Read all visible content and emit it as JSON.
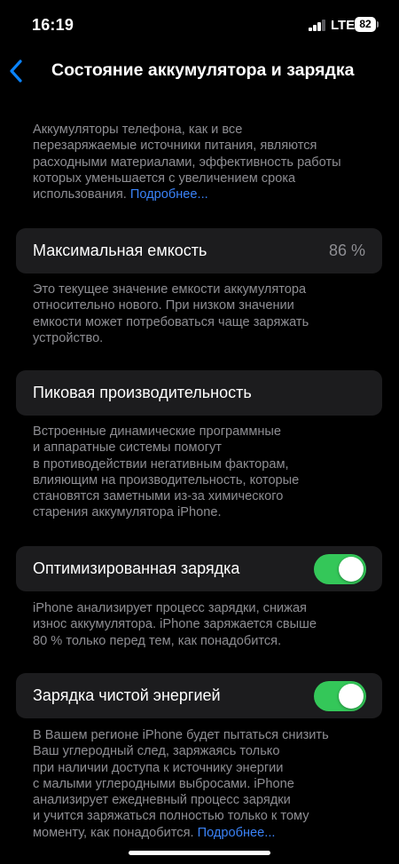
{
  "status_bar": {
    "time": "16:19",
    "network": "LTE",
    "battery": "82"
  },
  "nav": {
    "back_icon": "chevron-left-icon",
    "title": "Состояние аккумулятора и зарядка"
  },
  "intro": {
    "lines": [
      "Аккумуляторы телефона, как и все",
      "перезаряжаемые источники питания, являются",
      "расходными материалами, эффективность работы",
      "которых уменьшается с увеличением срока"
    ],
    "last_line": "использования.",
    "link": "Подробнее..."
  },
  "max_capacity": {
    "label": "Максимальная емкость",
    "value": "86 %",
    "description": [
      "Это текущее значение емкости аккумулятора",
      "относительно нового. При низком значении",
      "емкости может потребоваться чаще заряжать",
      "устройство."
    ]
  },
  "peak_performance": {
    "label": "Пиковая производительность",
    "description": [
      "Встроенные динамические программные",
      "и аппаратные системы помогут",
      "в противодействии негативным факторам,",
      "влияющим на производительность, которые",
      "становятся заметными из-за химического",
      "старения аккумулятора iPhone."
    ]
  },
  "optimized_charging": {
    "label": "Оптимизированная зарядка",
    "enabled": true,
    "description": [
      "iPhone анализирует процесс зарядки, снижая",
      "износ аккумулятора. iPhone заряжается свыше",
      "80 % только перед тем, как понадобится."
    ]
  },
  "clean_energy_charging": {
    "label": "Зарядка чистой энергией",
    "enabled": true,
    "description": [
      "В Вашем регионе iPhone будет пытаться снизить",
      "Ваш углеродный след, заряжаясь только",
      "при наличии доступа к источнику энергии",
      "с малыми углеродными выбросами. iPhone",
      "анализирует ежедневный процесс зарядки",
      "и учится заряжаться полностью только к тому"
    ],
    "last_line": "моменту, как понадобится.",
    "link": "Подробнее..."
  },
  "colors": {
    "background": "#000000",
    "cell": "#1c1c1e",
    "secondary_text": "#8e8e93",
    "link": "#3a82f7",
    "toggle_on": "#34c759"
  }
}
